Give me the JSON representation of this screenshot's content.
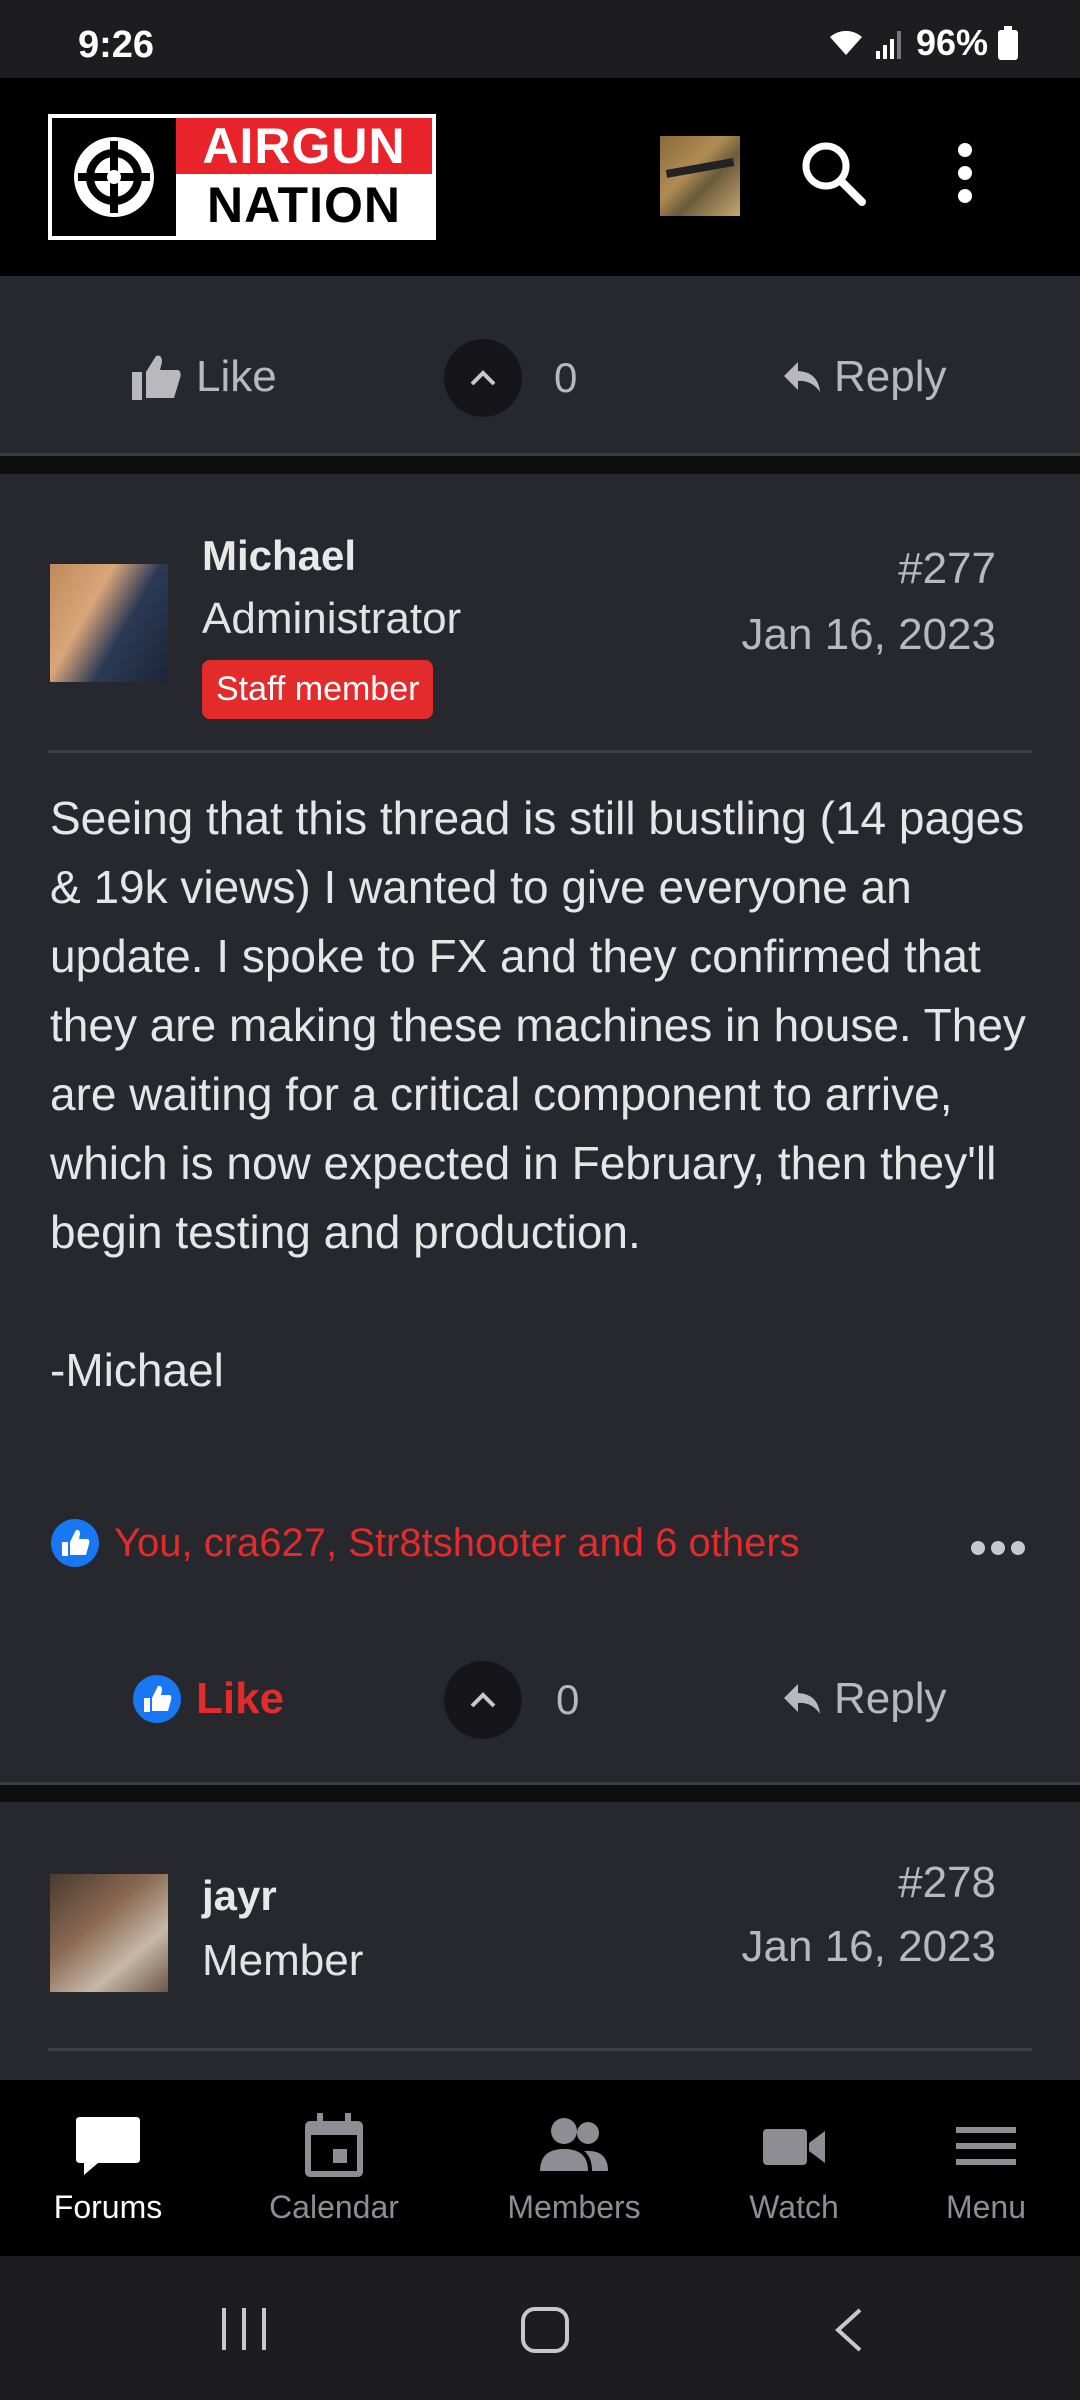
{
  "status_bar": {
    "time": "9:26",
    "battery_percent": "96%",
    "icons": [
      "wifi-icon",
      "signal-icon",
      "battery-icon"
    ]
  },
  "header": {
    "logo_top": "AIRGUN",
    "logo_bottom": "NATION",
    "icons": [
      "user-avatar",
      "search-icon",
      "more-vert-icon"
    ]
  },
  "prev_post_actions": {
    "like_label": "Like",
    "vote_count": "0",
    "reply_label": "Reply"
  },
  "posts": [
    {
      "author": "Michael",
      "role": "Administrator",
      "badge": "Staff member",
      "number": "#277",
      "date": "Jan 16, 2023",
      "body": [
        "Seeing that this thread is still bustling (14 pages & 19k views) I wanted to give everyone an update. I spoke to FX and they confirmed that they are making these machines in house. They are waiting for a critical component to arrive, which is now expected in February, then they'll begin testing and production.",
        "-Michael"
      ],
      "reactions_text": "You, cra627, Str8tshooter and 6 others",
      "like_label": "Like",
      "vote_count": "0",
      "reply_label": "Reply"
    },
    {
      "author": "jayr",
      "role": "Member",
      "number": "#278",
      "date": "Jan 16, 2023"
    }
  ],
  "bottom_nav": [
    {
      "label": "Forums",
      "icon": "forums-icon",
      "active": true
    },
    {
      "label": "Calendar",
      "icon": "calendar-icon",
      "active": false
    },
    {
      "label": "Members",
      "icon": "members-icon",
      "active": false
    },
    {
      "label": "Watch",
      "icon": "video-icon",
      "active": false
    },
    {
      "label": "Menu",
      "icon": "menu-icon",
      "active": false
    }
  ],
  "colors": {
    "accent": "#e32b2b",
    "like_blue": "#1877f2",
    "card_bg": "#27282d",
    "page_bg": "#0f0f11"
  }
}
